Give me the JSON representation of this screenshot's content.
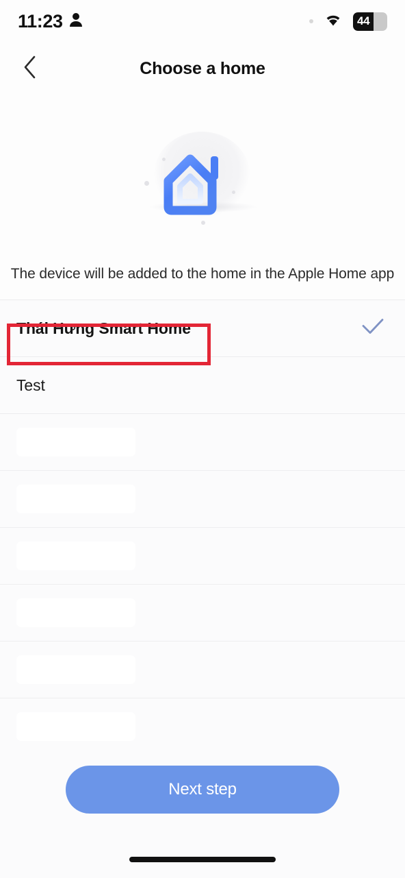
{
  "status_bar": {
    "time": "11:23",
    "person_icon": "person-icon",
    "dot_icon": "dot-indicator-icon",
    "wifi_icon": "wifi-icon",
    "battery_level": "44",
    "battery_icon": "battery-icon"
  },
  "nav": {
    "back_icon": "chevron-left-icon",
    "title": "Choose a home"
  },
  "hero": {
    "icon": "house-illustration",
    "house_color": "#4a7ef5",
    "house_color_light": "#9dbcff"
  },
  "description": {
    "text": "The device will be added to the home in the Apple Home app"
  },
  "home_list": {
    "items": [
      {
        "label": "Thái Hưng Smart Home",
        "selected": true,
        "check_icon": "check-icon"
      },
      {
        "label": "Test",
        "selected": false
      }
    ],
    "placeholder_rows": 6
  },
  "annotation": {
    "color": "#e32636",
    "target": "Thái Hưng Smart Home"
  },
  "footer": {
    "next_label": "Next step",
    "next_color": "#6b95e8",
    "home_indicator": "home-indicator"
  }
}
